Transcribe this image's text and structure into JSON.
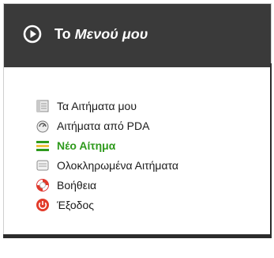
{
  "header": {
    "title_prefix": "Το ",
    "title_emph": "Μενού μου",
    "icon": "play-circle-icon"
  },
  "menu": {
    "items": [
      {
        "label": "Τα Αιτήματα μου",
        "icon": "document-list-icon"
      },
      {
        "label": "Αιτήματα από PDA",
        "icon": "pda-device-icon"
      },
      {
        "label": "Νέο Αίτημα",
        "icon": "new-request-icon",
        "active": true
      },
      {
        "label": "Ολοκληρωμένα Αιτήματα",
        "icon": "completed-list-icon"
      },
      {
        "label": "Βοήθεια",
        "icon": "help-lifebuoy-icon"
      },
      {
        "label": "Έξοδος",
        "icon": "exit-power-icon"
      }
    ]
  },
  "colors": {
    "header_bg": "#3a3a3a",
    "active_text": "#2e9a1c"
  }
}
